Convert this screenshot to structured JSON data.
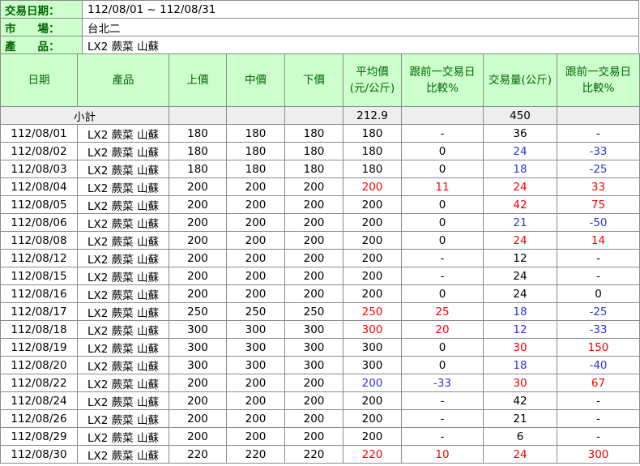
{
  "info": {
    "date_label": "交易日期：",
    "date_value": "112/08/01 ~ 112/08/31",
    "market_label": "市　　場：",
    "market_value": "台北二",
    "product_label": "產　　品：",
    "product_value": "LX2 蕨菜 山蘇"
  },
  "headers": {
    "date": "日期",
    "product": "產品",
    "upper": "上價",
    "middle": "中價",
    "lower": "下價",
    "avg_l1": "平均價",
    "avg_l2": "(元/公斤)",
    "pchg_l1": "跟前一交易日",
    "pchg_l2": "比較%",
    "volume": "交易量(公斤)",
    "vchg_l1": "跟前一交易日",
    "vchg_l2": "比較%"
  },
  "subtotal": {
    "label": "小計",
    "avg": "212.9",
    "volume": "450"
  },
  "colors": {
    "header_bg": "#ccffcc",
    "header_text": "#006600",
    "up": "#ff0000",
    "down": "#3333dd",
    "subtotal_bg": "#eeeeee"
  },
  "rows": [
    {
      "date": "112/08/01",
      "product": "LX2 蕨菜 山蘇",
      "upper": "180",
      "middle": "180",
      "lower": "180",
      "avg": "180",
      "avg_t": "n",
      "pchg": "-",
      "pchg_t": "n",
      "vol": "36",
      "vol_t": "n",
      "vchg": "-",
      "vchg_t": "n"
    },
    {
      "date": "112/08/02",
      "product": "LX2 蕨菜 山蘇",
      "upper": "180",
      "middle": "180",
      "lower": "180",
      "avg": "180",
      "avg_t": "n",
      "pchg": "0",
      "pchg_t": "n",
      "vol": "24",
      "vol_t": "d",
      "vchg": "-33",
      "vchg_t": "d"
    },
    {
      "date": "112/08/03",
      "product": "LX2 蕨菜 山蘇",
      "upper": "180",
      "middle": "180",
      "lower": "180",
      "avg": "180",
      "avg_t": "n",
      "pchg": "0",
      "pchg_t": "n",
      "vol": "18",
      "vol_t": "d",
      "vchg": "-25",
      "vchg_t": "d"
    },
    {
      "date": "112/08/04",
      "product": "LX2 蕨菜 山蘇",
      "upper": "200",
      "middle": "200",
      "lower": "200",
      "avg": "200",
      "avg_t": "u",
      "pchg": "11",
      "pchg_t": "u",
      "vol": "24",
      "vol_t": "u",
      "vchg": "33",
      "vchg_t": "u"
    },
    {
      "date": "112/08/05",
      "product": "LX2 蕨菜 山蘇",
      "upper": "200",
      "middle": "200",
      "lower": "200",
      "avg": "200",
      "avg_t": "n",
      "pchg": "0",
      "pchg_t": "n",
      "vol": "42",
      "vol_t": "u",
      "vchg": "75",
      "vchg_t": "u"
    },
    {
      "date": "112/08/06",
      "product": "LX2 蕨菜 山蘇",
      "upper": "200",
      "middle": "200",
      "lower": "200",
      "avg": "200",
      "avg_t": "n",
      "pchg": "0",
      "pchg_t": "n",
      "vol": "21",
      "vol_t": "d",
      "vchg": "-50",
      "vchg_t": "d"
    },
    {
      "date": "112/08/08",
      "product": "LX2 蕨菜 山蘇",
      "upper": "200",
      "middle": "200",
      "lower": "200",
      "avg": "200",
      "avg_t": "n",
      "pchg": "0",
      "pchg_t": "n",
      "vol": "24",
      "vol_t": "u",
      "vchg": "14",
      "vchg_t": "u"
    },
    {
      "date": "112/08/12",
      "product": "LX2 蕨菜 山蘇",
      "upper": "200",
      "middle": "200",
      "lower": "200",
      "avg": "200",
      "avg_t": "n",
      "pchg": "-",
      "pchg_t": "n",
      "vol": "12",
      "vol_t": "n",
      "vchg": "-",
      "vchg_t": "n"
    },
    {
      "date": "112/08/15",
      "product": "LX2 蕨菜 山蘇",
      "upper": "200",
      "middle": "200",
      "lower": "200",
      "avg": "200",
      "avg_t": "n",
      "pchg": "-",
      "pchg_t": "n",
      "vol": "24",
      "vol_t": "n",
      "vchg": "-",
      "vchg_t": "n"
    },
    {
      "date": "112/08/16",
      "product": "LX2 蕨菜 山蘇",
      "upper": "200",
      "middle": "200",
      "lower": "200",
      "avg": "200",
      "avg_t": "n",
      "pchg": "0",
      "pchg_t": "n",
      "vol": "24",
      "vol_t": "n",
      "vchg": "0",
      "vchg_t": "n"
    },
    {
      "date": "112/08/17",
      "product": "LX2 蕨菜 山蘇",
      "upper": "250",
      "middle": "250",
      "lower": "250",
      "avg": "250",
      "avg_t": "u",
      "pchg": "25",
      "pchg_t": "u",
      "vol": "18",
      "vol_t": "d",
      "vchg": "-25",
      "vchg_t": "d"
    },
    {
      "date": "112/08/18",
      "product": "LX2 蕨菜 山蘇",
      "upper": "300",
      "middle": "300",
      "lower": "300",
      "avg": "300",
      "avg_t": "u",
      "pchg": "20",
      "pchg_t": "u",
      "vol": "12",
      "vol_t": "d",
      "vchg": "-33",
      "vchg_t": "d"
    },
    {
      "date": "112/08/19",
      "product": "LX2 蕨菜 山蘇",
      "upper": "300",
      "middle": "300",
      "lower": "300",
      "avg": "300",
      "avg_t": "n",
      "pchg": "0",
      "pchg_t": "n",
      "vol": "30",
      "vol_t": "u",
      "vchg": "150",
      "vchg_t": "u"
    },
    {
      "date": "112/08/20",
      "product": "LX2 蕨菜 山蘇",
      "upper": "300",
      "middle": "300",
      "lower": "300",
      "avg": "300",
      "avg_t": "n",
      "pchg": "0",
      "pchg_t": "n",
      "vol": "18",
      "vol_t": "d",
      "vchg": "-40",
      "vchg_t": "d"
    },
    {
      "date": "112/08/22",
      "product": "LX2 蕨菜 山蘇",
      "upper": "200",
      "middle": "200",
      "lower": "200",
      "avg": "200",
      "avg_t": "d",
      "pchg": "-33",
      "pchg_t": "d",
      "vol": "30",
      "vol_t": "u",
      "vchg": "67",
      "vchg_t": "u"
    },
    {
      "date": "112/08/24",
      "product": "LX2 蕨菜 山蘇",
      "upper": "200",
      "middle": "200",
      "lower": "200",
      "avg": "200",
      "avg_t": "n",
      "pchg": "-",
      "pchg_t": "n",
      "vol": "42",
      "vol_t": "n",
      "vchg": "-",
      "vchg_t": "n"
    },
    {
      "date": "112/08/26",
      "product": "LX2 蕨菜 山蘇",
      "upper": "200",
      "middle": "200",
      "lower": "200",
      "avg": "200",
      "avg_t": "n",
      "pchg": "-",
      "pchg_t": "n",
      "vol": "21",
      "vol_t": "n",
      "vchg": "-",
      "vchg_t": "n"
    },
    {
      "date": "112/08/29",
      "product": "LX2 蕨菜 山蘇",
      "upper": "200",
      "middle": "200",
      "lower": "200",
      "avg": "200",
      "avg_t": "n",
      "pchg": "-",
      "pchg_t": "n",
      "vol": "6",
      "vol_t": "n",
      "vchg": "-",
      "vchg_t": "n"
    },
    {
      "date": "112/08/30",
      "product": "LX2 蕨菜 山蘇",
      "upper": "220",
      "middle": "220",
      "lower": "220",
      "avg": "220",
      "avg_t": "u",
      "pchg": "10",
      "pchg_t": "u",
      "vol": "24",
      "vol_t": "u",
      "vchg": "300",
      "vchg_t": "u"
    }
  ]
}
